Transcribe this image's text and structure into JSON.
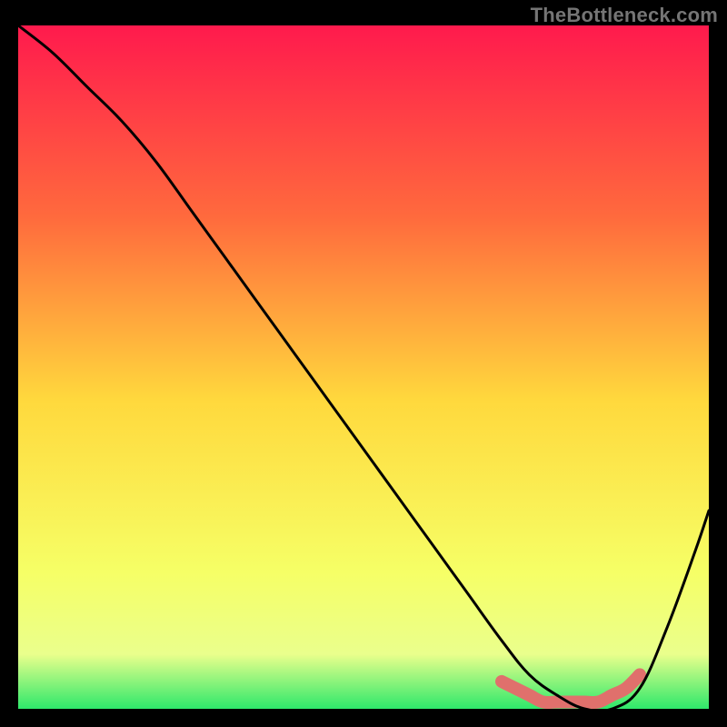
{
  "watermark": "TheBottleneck.com",
  "colors": {
    "bg": "#000000",
    "grad_top": "#ff1a4d",
    "grad_upper_mid": "#ff6a3d",
    "grad_mid": "#ffd93d",
    "grad_lower_mid": "#f6ff66",
    "grad_low": "#eaff8c",
    "grad_bottom": "#2ee86b",
    "curve": "#000000",
    "blob": "#e0706c",
    "watermark": "#757575"
  },
  "chart_data": {
    "type": "line",
    "title": "",
    "xlabel": "",
    "ylabel": "",
    "xlim": [
      0,
      100
    ],
    "ylim": [
      0,
      100
    ],
    "grid": false,
    "legend": false,
    "annotations": [
      "TheBottleneck.com"
    ],
    "series": [
      {
        "name": "bottleneck-curve",
        "x": [
          0,
          5,
          10,
          15,
          20,
          25,
          30,
          35,
          40,
          45,
          50,
          55,
          60,
          65,
          70,
          74,
          78,
          82,
          86,
          90,
          94,
          98,
          100
        ],
        "y": [
          100,
          96,
          91,
          86,
          80,
          73,
          66,
          59,
          52,
          45,
          38,
          31,
          24,
          17,
          10,
          5,
          2,
          0,
          0,
          3,
          12,
          23,
          29
        ]
      },
      {
        "name": "optimal-band-marker",
        "x": [
          70,
          72,
          74,
          76,
          78,
          80,
          82,
          84,
          86,
          88,
          90
        ],
        "y": [
          4,
          3,
          2,
          1,
          1,
          1,
          1,
          1,
          2,
          3,
          5
        ]
      }
    ]
  }
}
